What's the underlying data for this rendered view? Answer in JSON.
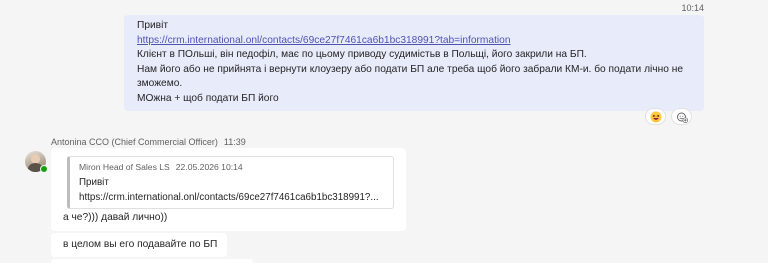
{
  "own_message": {
    "time": "10:14",
    "lines": [
      "Привіт",
      "https://crm.international.onl/contacts/69ce27f7461ca6b1bc318991?tab=information",
      "Клієнт в ПОльші, він педофіл, має по цьому приводу судимістьв в Польщі, його закрили на БП.",
      "Нам його або не прийнята і вернути клоузеру або подати БП але треба щоб його забрали КМ-и. бо подати лічно не",
      "зможемо.",
      "МОжна + щоб подати БП його"
    ],
    "reactions": [
      {
        "icon": "laughing-emoji-icon"
      },
      {
        "icon": "add-reaction-icon"
      }
    ]
  },
  "thread": {
    "sender": "Antonina CCO (Chief Commercial Officer)",
    "time": "11:39",
    "quote": {
      "author": "Miron Head of Sales LS",
      "date": "22.05.2026 10:14",
      "line1": "Привіт",
      "line2": "https://crm.international.onl/contacts/69ce27f7461ca6b1bc318991?..."
    },
    "reply": "а че?))) давай лично))",
    "message2": "в целом вы его подавайте по БП"
  },
  "colors": {
    "own_bubble": "#e8ebfa",
    "link": "#4f52b2",
    "presence": "#13a10e"
  }
}
